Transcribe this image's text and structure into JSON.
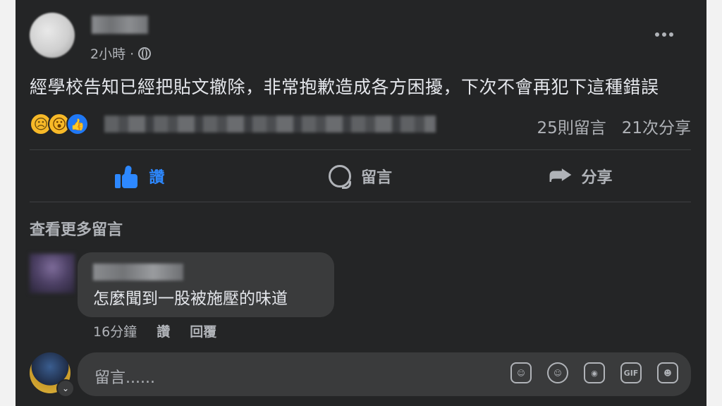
{
  "post": {
    "time": "2小時 ·",
    "text": "經學校告知已經把貼文撤除，非常抱歉造成各方困擾，下次不會再犯下這種錯誤",
    "comment_count": "25則留言",
    "share_count": "21次分享"
  },
  "actions": {
    "like": "讚",
    "comment": "留言",
    "share": "分享"
  },
  "comments": {
    "more_label": "查看更多留言",
    "items": [
      {
        "text": "怎麼聞到一股被施壓的味道",
        "time": "16分鐘",
        "like": "讚",
        "reply": "回覆"
      }
    ]
  },
  "composer": {
    "placeholder": "留言......"
  },
  "colors": {
    "card_bg": "#242526",
    "bubble_bg": "#3a3b3c",
    "like_blue": "#2d88ff",
    "secondary_text": "#b0b3b8"
  }
}
